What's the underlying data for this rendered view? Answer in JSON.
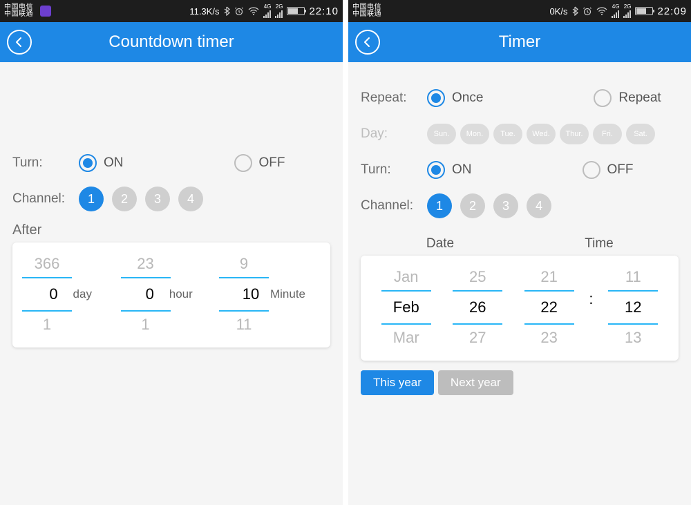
{
  "left": {
    "status": {
      "carrier1": "中国电信",
      "carrier2": "中国联通",
      "speed": "11.3K/s",
      "net1": "4G",
      "net2": "2G",
      "time": "22:10"
    },
    "header_title": "Countdown timer",
    "turn_label": "Turn:",
    "on_label": "ON",
    "off_label": "OFF",
    "channel_label": "Channel:",
    "channels": [
      "1",
      "2",
      "3",
      "4"
    ],
    "after_label": "After",
    "picker": {
      "day": {
        "prev": "366",
        "val": "0",
        "next": "1",
        "unit": "day"
      },
      "hour": {
        "prev": "23",
        "val": "0",
        "next": "1",
        "unit": "hour"
      },
      "minute": {
        "prev": "9",
        "val": "10",
        "next": "11",
        "unit": "Minute"
      }
    }
  },
  "right": {
    "status": {
      "carrier1": "中国电信",
      "carrier2": "中国联通",
      "speed": "0K/s",
      "net1": "4G",
      "net2": "2G",
      "time": "22:09"
    },
    "header_title": "Timer",
    "repeat_label": "Repeat:",
    "once_label": "Once",
    "repeat_opt_label": "Repeat",
    "day_label": "Day:",
    "days": [
      "Sun.",
      "Mon.",
      "Tue.",
      "Wed.",
      "Thur.",
      "Fri.",
      "Sat."
    ],
    "turn_label": "Turn:",
    "on_label": "ON",
    "off_label": "OFF",
    "channel_label": "Channel:",
    "channels": [
      "1",
      "2",
      "3",
      "4"
    ],
    "date_header": "Date",
    "time_header": "Time",
    "picker": {
      "month": {
        "prev": "Jan",
        "val": "Feb",
        "next": "Mar"
      },
      "day": {
        "prev": "25",
        "val": "26",
        "next": "27"
      },
      "hour": {
        "prev": "21",
        "val": "22",
        "next": "23"
      },
      "minute": {
        "prev": "11",
        "val": "12",
        "next": "13"
      },
      "colon": ":"
    },
    "this_year": "This year",
    "next_year": "Next year"
  }
}
